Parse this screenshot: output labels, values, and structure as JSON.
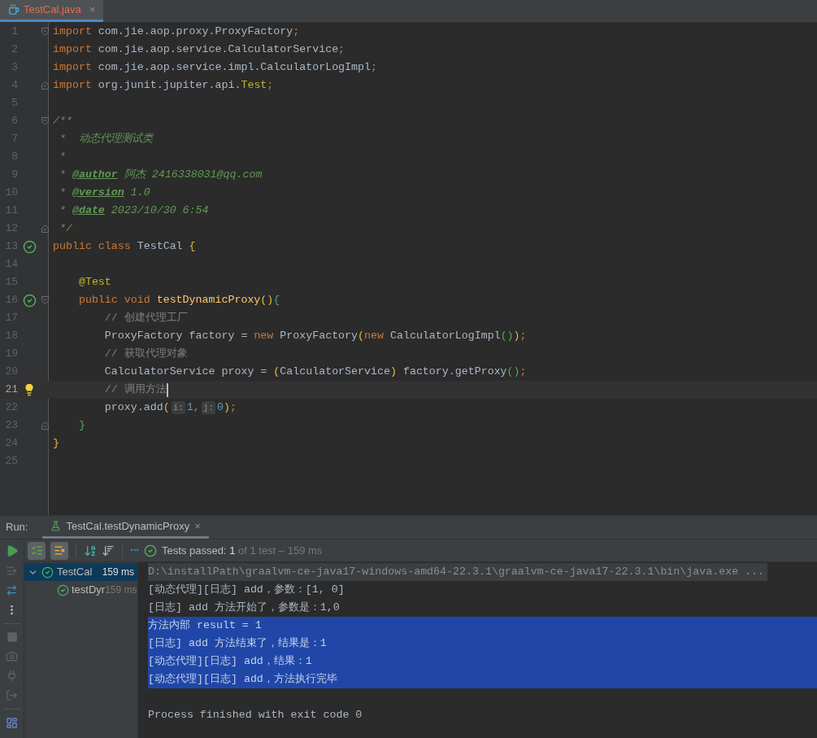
{
  "editor_tab": {
    "label": "TestCal.java",
    "selected": true,
    "close": "×"
  },
  "code_lines": [
    {
      "number": "1",
      "current": false,
      "fold": {
        "kind": "start"
      },
      "tokens": [
        {
          "kind": "kw",
          "text": "import"
        },
        {
          "kind": "plain",
          "text": " com.jie.aop.proxy.ProxyFactory"
        },
        {
          "kind": "kw",
          "text": ";"
        }
      ]
    },
    {
      "number": "2",
      "current": false,
      "tokens": [
        {
          "kind": "kw",
          "text": "import"
        },
        {
          "kind": "plain",
          "text": " com.jie.aop.service.CalculatorService"
        },
        {
          "kind": "kw",
          "text": ";"
        }
      ]
    },
    {
      "number": "3",
      "current": false,
      "tokens": [
        {
          "kind": "kw",
          "text": "import"
        },
        {
          "kind": "plain",
          "text": " com.jie.aop.service.impl.CalculatorLogImpl"
        },
        {
          "kind": "kw",
          "text": ";"
        }
      ]
    },
    {
      "number": "4",
      "current": false,
      "fold": {
        "kind": "end"
      },
      "tokens": [
        {
          "kind": "kw",
          "text": "import"
        },
        {
          "kind": "plain",
          "text": " org.junit.jupiter.api."
        },
        {
          "kind": "ann",
          "text": "Test"
        },
        {
          "kind": "kw",
          "text": ";"
        }
      ]
    },
    {
      "number": "5",
      "current": false
    },
    {
      "number": "6",
      "current": false,
      "fold": {
        "kind": "start"
      },
      "tokens": [
        {
          "kind": "doc",
          "text": "/**"
        }
      ]
    },
    {
      "number": "7",
      "current": false,
      "tokens": [
        {
          "kind": "doc",
          "text": " *  动态代理测试类"
        }
      ]
    },
    {
      "number": "8",
      "current": false,
      "tokens": [
        {
          "kind": "doc",
          "text": " *"
        }
      ]
    },
    {
      "number": "9",
      "current": false,
      "tokens": [
        {
          "kind": "doc",
          "text": " * "
        },
        {
          "kind": "doctag",
          "text": "@author"
        },
        {
          "kind": "doc",
          "text": " 阿杰 2416338031@qq.com"
        }
      ]
    },
    {
      "number": "10",
      "current": false,
      "tokens": [
        {
          "kind": "doc",
          "text": " * "
        },
        {
          "kind": "doctag",
          "text": "@version"
        },
        {
          "kind": "doc",
          "text": " 1.0"
        }
      ]
    },
    {
      "number": "11",
      "current": false,
      "tokens": [
        {
          "kind": "doc",
          "text": " * "
        },
        {
          "kind": "doctag",
          "text": "@date"
        },
        {
          "kind": "doc",
          "text": " 2023/10/30 6:54"
        }
      ]
    },
    {
      "number": "12",
      "current": false,
      "fold": {
        "kind": "end"
      },
      "tokens": [
        {
          "kind": "doc",
          "text": " */"
        }
      ]
    },
    {
      "number": "13",
      "current": false,
      "marker": {
        "kind": "passed"
      },
      "tokens": [
        {
          "kind": "kw",
          "text": "public class "
        },
        {
          "kind": "plain",
          "text": "TestCal "
        },
        {
          "kind": "p1",
          "text": "{"
        }
      ]
    },
    {
      "number": "14",
      "current": false
    },
    {
      "number": "15",
      "current": false,
      "tokens": [
        {
          "kind": "ann",
          "text": "    @Test"
        }
      ]
    },
    {
      "number": "16",
      "current": false,
      "marker": {
        "kind": "passed"
      },
      "fold": {
        "kind": "start"
      },
      "tokens": [
        {
          "kind": "kw",
          "text": "    public void "
        },
        {
          "kind": "method",
          "text": "testDynamicProxy"
        },
        {
          "kind": "p1",
          "text": "()"
        },
        {
          "kind": "p2",
          "text": "{"
        }
      ]
    },
    {
      "number": "17",
      "current": false,
      "tokens": [
        {
          "kind": "comment",
          "text": "        // 创建代理工厂"
        }
      ]
    },
    {
      "number": "18",
      "current": false,
      "tokens": [
        {
          "kind": "plain",
          "text": "        ProxyFactory factory = "
        },
        {
          "kind": "kw",
          "text": "new "
        },
        {
          "kind": "plain",
          "text": "ProxyFactory"
        },
        {
          "kind": "p1",
          "text": "("
        },
        {
          "kind": "kw",
          "text": "new "
        },
        {
          "kind": "plain",
          "text": "CalculatorLogImpl"
        },
        {
          "kind": "p2",
          "text": "()"
        },
        {
          "kind": "p1",
          "text": ")"
        },
        {
          "kind": "kw",
          "text": ";"
        }
      ]
    },
    {
      "number": "19",
      "current": false,
      "tokens": [
        {
          "kind": "comment",
          "text": "        // 获取代理对象"
        }
      ]
    },
    {
      "number": "20",
      "current": false,
      "tokens": [
        {
          "kind": "plain",
          "text": "        CalculatorService proxy = "
        },
        {
          "kind": "p1",
          "text": "("
        },
        {
          "kind": "plain",
          "text": "CalculatorService"
        },
        {
          "kind": "p1",
          "text": ")"
        },
        {
          "kind": "plain",
          "text": " factory.getProxy"
        },
        {
          "kind": "p2",
          "text": "()"
        },
        {
          "kind": "kw",
          "text": ";"
        }
      ]
    },
    {
      "number": "21",
      "current": true,
      "marker": {
        "kind": "bulb"
      },
      "tokens": [
        {
          "kind": "comment",
          "text": "        // 调用方法"
        }
      ]
    },
    {
      "number": "22",
      "current": false,
      "tokens": [
        {
          "kind": "plain",
          "text": "        proxy.add"
        },
        {
          "kind": "p1",
          "text": "("
        },
        {
          "kind": "hint",
          "text": "i:"
        },
        {
          "kind": "num",
          "text": "1"
        },
        {
          "kind": "kw",
          "text": ","
        },
        {
          "kind": "hint",
          "text": "j:"
        },
        {
          "kind": "num",
          "text": "0"
        },
        {
          "kind": "p1",
          "text": ")"
        },
        {
          "kind": "kw",
          "text": ";"
        }
      ]
    },
    {
      "number": "23",
      "current": false,
      "fold": {
        "kind": "end"
      },
      "tokens": [
        {
          "kind": "p2",
          "text": "    }"
        }
      ]
    },
    {
      "number": "24",
      "current": false,
      "tokens": [
        {
          "kind": "p1",
          "text": "}"
        }
      ]
    },
    {
      "number": "25",
      "current": false
    }
  ],
  "run_panel": {
    "label": "Run:",
    "tab": {
      "label": "TestCal.testDynamicProxy",
      "selected": true,
      "close": "×"
    },
    "toolbar": {
      "show_passed": true,
      "show_ignored": true,
      "more": "···",
      "status": "Tests passed:",
      "passed": "1",
      "summary": "of 1 test – 159 ms"
    },
    "tree": [
      {
        "name": "TestCal",
        "time": "159 ms",
        "selected": true,
        "expanded": true,
        "children": [
          {
            "name": "testDyr",
            "time": "159 ms",
            "selected": false
          }
        ]
      }
    ],
    "console": [
      {
        "kind": "command",
        "selected": false,
        "text": "D:\\installPath\\graalvm-ce-java17-windows-amd64-22.3.1\\graalvm-ce-java17-22.3.1\\bin\\java.exe ..."
      },
      {
        "kind": "output",
        "selected": false,
        "text": "[动态代理][日志] add，参数：[1, 0]"
      },
      {
        "kind": "output",
        "selected": false,
        "text": "[日志] add 方法开始了，参数是：1,0"
      },
      {
        "kind": "output",
        "selected": true,
        "text": "方法内部 result = 1"
      },
      {
        "kind": "output",
        "selected": true,
        "text": "[日志] add 方法结束了，结果是：1"
      },
      {
        "kind": "output",
        "selected": true,
        "text": "[动态代理][日志] add，结果：1"
      },
      {
        "kind": "output",
        "selected": true,
        "text": "[动态代理][日志] add，方法执行完毕"
      },
      {
        "kind": "blank",
        "selected": false
      },
      {
        "kind": "output",
        "selected": false,
        "text": "Process finished with exit code 0"
      }
    ]
  }
}
